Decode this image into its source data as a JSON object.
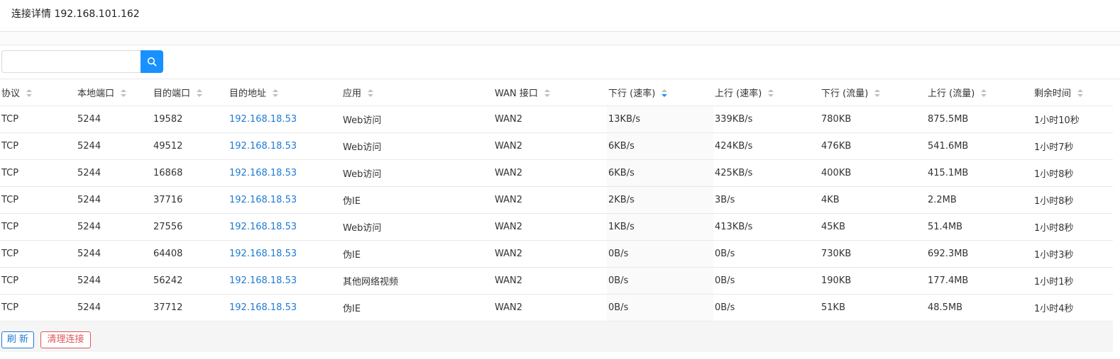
{
  "header": {
    "title": "连接详情 192.168.101.162"
  },
  "search": {
    "placeholder": "",
    "value": ""
  },
  "icons": {
    "search": "search-icon",
    "sort": "sort-icon"
  },
  "colors": {
    "accent": "#1890ff",
    "link": "#1f7bd2",
    "danger": "#e0565b"
  },
  "table": {
    "columns": [
      "协议",
      "本地端口",
      "目的端口",
      "目的地址",
      "应用",
      "WAN 接口",
      "下行 (速率)",
      "上行 (速率)",
      "下行 (流量)",
      "上行 (流量)",
      "剩余时间"
    ],
    "sorted_column": "下行 (速率)",
    "sort_direction": "descending",
    "rows": [
      [
        "TCP",
        "5244",
        "19582",
        "192.168.18.53",
        "Web访问",
        "WAN2",
        "13KB/s",
        "339KB/s",
        "780KB",
        "875.5MB",
        "1小时10秒"
      ],
      [
        "TCP",
        "5244",
        "49512",
        "192.168.18.53",
        "Web访问",
        "WAN2",
        "6KB/s",
        "424KB/s",
        "476KB",
        "541.6MB",
        "1小时7秒"
      ],
      [
        "TCP",
        "5244",
        "16868",
        "192.168.18.53",
        "Web访问",
        "WAN2",
        "6KB/s",
        "425KB/s",
        "400KB",
        "415.1MB",
        "1小时8秒"
      ],
      [
        "TCP",
        "5244",
        "37716",
        "192.168.18.53",
        "伪IE",
        "WAN2",
        "2KB/s",
        "3B/s",
        "4KB",
        "2.2MB",
        "1小时8秒"
      ],
      [
        "TCP",
        "5244",
        "27556",
        "192.168.18.53",
        "Web访问",
        "WAN2",
        "1KB/s",
        "413KB/s",
        "45KB",
        "51.4MB",
        "1小时8秒"
      ],
      [
        "TCP",
        "5244",
        "64408",
        "192.168.18.53",
        "伪IE",
        "WAN2",
        "0B/s",
        "0B/s",
        "730KB",
        "692.3MB",
        "1小时3秒"
      ],
      [
        "TCP",
        "5244",
        "56242",
        "192.168.18.53",
        "其他网络视频",
        "WAN2",
        "0B/s",
        "0B/s",
        "190KB",
        "177.4MB",
        "1小时1秒"
      ],
      [
        "TCP",
        "5244",
        "37712",
        "192.168.18.53",
        "伪IE",
        "WAN2",
        "0B/s",
        "0B/s",
        "51KB",
        "48.5MB",
        "1小时4秒"
      ]
    ]
  },
  "footer": {
    "refresh_label": "刷 新",
    "clear_label": "清理连接"
  }
}
